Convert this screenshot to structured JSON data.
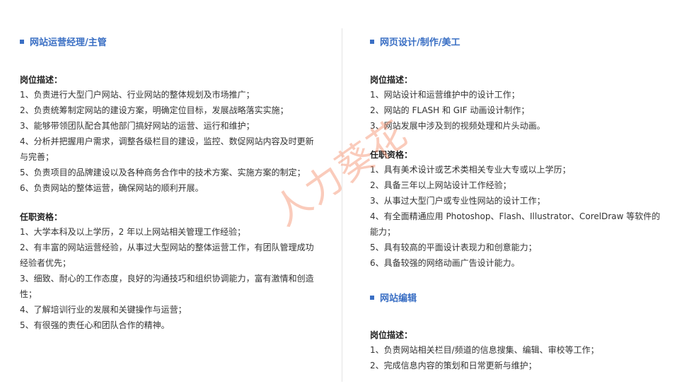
{
  "left": {
    "job": {
      "title": "网站运营经理/主管",
      "desc_heading": "岗位描述：",
      "desc": [
        "1、负责进行大型门户网站、行业网站的整体规划及市场推广；",
        "2、负责统筹制定网站的建设方案，明确定位目标，发展战略落实实施；",
        "3、能够带领团队配合其他部门搞好网站的运营、运行和维护；",
        "4、分析并把握用户需求，调整各级栏目的建设，监控、数促网站内容及时更新与完善；",
        "5、负责项目的品牌建设以及各种商务合作中的技术方案、实施方案的制定；",
        "6、负责网站的整体运营，确保网站的顺利开展。"
      ],
      "req_heading": "任职资格：",
      "req": [
        "1、大学本科及以上学历，2 年以上网站相关管理工作经验；",
        "2、有丰富的网站运营经验，从事过大型网站的整体运营工作，有团队管理成功经验者优先；",
        "3、细致、耐心的工作态度，良好的沟通技巧和组织协调能力，富有激情和创造性；",
        "4、了解培训行业的发展和关键操作与运营；",
        "5、有很强的责任心和团队合作的精神。"
      ]
    }
  },
  "right": {
    "job1": {
      "title": "网页设计/制作/美工",
      "desc_heading": "岗位描述：",
      "desc": [
        "1、网站设计和运营维护中的设计工作；",
        "2、网站的 FLASH 和 GIF 动画设计制作；",
        "3、网站发展中涉及到的视频处理和片头动画。"
      ],
      "req_heading": "任职资格：",
      "req": [
        "1、具有美术设计或艺术类相关专业大专或以上学历；",
        "2、具备三年以上网站设计工作经验；",
        "3、从事过大型门户或专业性网站的设计工作；",
        "4、有全面精通应用 Photoshop、Flash、Illustrator、CorelDraw 等软件的能力；",
        "5、具有较高的平面设计表现力和创意能力；",
        "6、具备较强的网络动画广告设计能力。"
      ]
    },
    "job2": {
      "title": "网站编辑",
      "desc_heading": "岗位描述：",
      "desc": [
        "1、负责网站相关栏目/频道的信息搜集、编辑、审校等工作；",
        "2、完成信息内容的策划和日常更新与维护；"
      ]
    }
  },
  "watermark": "人力葵花",
  "colors": {
    "accent": "#3a6fc4",
    "watermark": "#f58c69"
  }
}
